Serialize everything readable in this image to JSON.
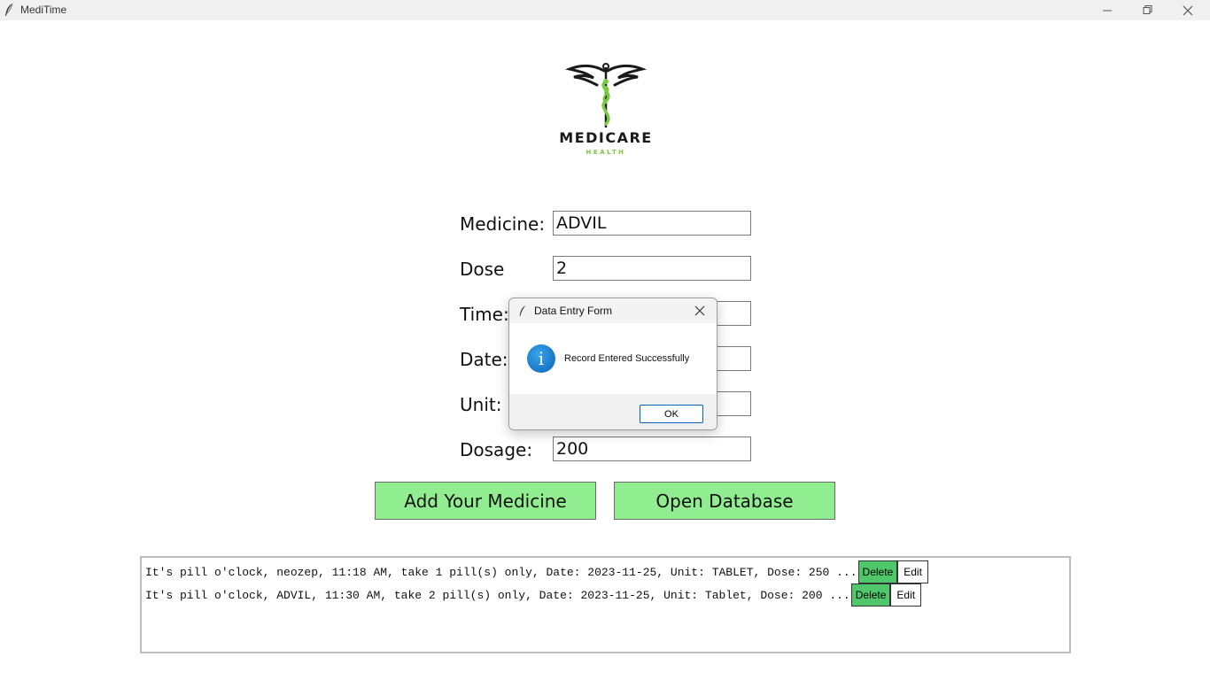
{
  "window": {
    "title": "MediTime"
  },
  "logo": {
    "brand": "MEDICARE",
    "sub": "HEALTH"
  },
  "form": {
    "medicine_label": "Medicine:",
    "medicine_value": "ADVIL",
    "dose_label": "Dose",
    "dose_value": "2",
    "time_label": "Time:",
    "time_value": "",
    "date_label": "Date:",
    "date_value": "",
    "unit_label": "Unit:",
    "unit_value": "",
    "dosage_label": "Dosage:",
    "dosage_value": "200"
  },
  "buttons": {
    "add": "Add Your Medicine",
    "open_db": "Open Database"
  },
  "records": [
    {
      "text": "It's pill o'clock, neozep, 11:18 AM, take 1 pill(s) only, Date: 2023-11-25, Unit: TABLET, Dose: 250 ...",
      "delete": "Delete",
      "edit": "Edit"
    },
    {
      "text": "It's pill o'clock, ADVIL, 11:30 AM, take 2 pill(s) only, Date: 2023-11-25, Unit: Tablet, Dose: 200 ...",
      "delete": "Delete",
      "edit": "Edit"
    }
  ],
  "dialog": {
    "title": "Data Entry Form",
    "message": "Record Entered Successfully",
    "ok": "OK",
    "icon": "info-icon"
  },
  "colors": {
    "button_green": "#90ee90",
    "delete_green": "#4fc76a",
    "logo_green": "#7bc943"
  }
}
